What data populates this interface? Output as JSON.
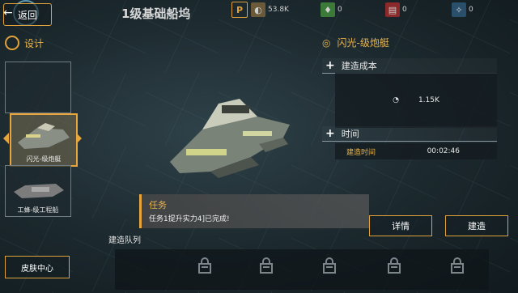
{
  "header": {
    "back_label": "返回",
    "title": "1级基础船坞"
  },
  "resources": [
    {
      "icon": "p-badge-icon",
      "value": "",
      "color": "#e0a23a"
    },
    {
      "icon": "ore-icon",
      "value": "53.8K",
      "color": "#6a5a3a"
    },
    {
      "icon": "crystal-icon",
      "value": "0",
      "color": "#3c7a3a"
    },
    {
      "icon": "gas-icon",
      "value": "0",
      "color": "#8a2a2a"
    },
    {
      "icon": "energy-icon",
      "value": "0",
      "color": "#2a4f6a"
    }
  ],
  "left_panel": {
    "design_label": "设计",
    "slots": [
      {
        "label": ""
      },
      {
        "label": "闪光-级炮艇"
      },
      {
        "label": "工蜂-级工程船"
      }
    ],
    "skin_center_label": "皮肤中心"
  },
  "right_panel": {
    "ship_name": "闪光-级炮艇",
    "cost_header": "建造成本",
    "cost_value": "1.15K",
    "time_header": "时间",
    "build_time_label": "建造时间",
    "build_time_value": "00:02:46",
    "details_label": "详情",
    "build_label": "建造"
  },
  "mission": {
    "title": "任务",
    "text": "任务1提升实力4]已完成!"
  },
  "queue": {
    "title": "建造队列",
    "slots": 5
  },
  "colors": {
    "accent": "#e0a23a",
    "accent_text": "#e8b34c"
  }
}
